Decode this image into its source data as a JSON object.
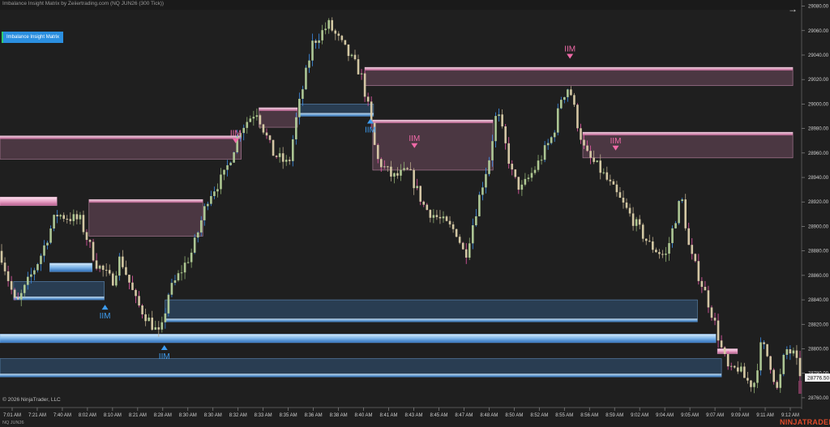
{
  "header": {
    "title": "Imbalance Insight Matrix by Zeiiertrading.com (NQ JUN26 (300 Tick))",
    "nav_icon": "arrow-right-icon"
  },
  "indicator": {
    "label": "Imbalance Insight Matrix"
  },
  "footer": {
    "copyright": "© 2026 NinjaTrader, LLC",
    "instrument": "NQ JUN26",
    "brand": "NINJATRADER"
  },
  "colors": {
    "background": "#1f1f1f",
    "bull_candle": "#b3cc96",
    "bear_candle": "#d9cda8",
    "bull_trend": "#3d8ee8",
    "bear_trend": "#e85aa8",
    "supply_zone": "#f2b8d6",
    "demand_zone": "#8ac0ee",
    "signal_bull": "#3d9cf0",
    "signal_bear": "#f06aa8"
  },
  "chart_data": {
    "type": "candlestick",
    "instrument": "NQ JUN26",
    "interval": "300 Tick",
    "price_axis": {
      "ticks": [
        28760,
        28780,
        28800,
        28820,
        28840,
        28860,
        28880,
        28900,
        28920,
        28940,
        28960,
        28980,
        29000,
        29020,
        29040,
        29060,
        29080
      ],
      "ylim": [
        28752,
        29085
      ],
      "current_price_label": "28776.50",
      "current_price": 28776.5
    },
    "time_axis": {
      "labels": [
        "7:01 AM",
        "7:21 AM",
        "7:40 AM",
        "8:02 AM",
        "8:10 AM",
        "8:21 AM",
        "8:28 AM",
        "8:30 AM",
        "8:30 AM",
        "8:32 AM",
        "8:33 AM",
        "8:35 AM",
        "8:36 AM",
        "8:38 AM",
        "8:40 AM",
        "8:41 AM",
        "8:43 AM",
        "8:45 AM",
        "8:47 AM",
        "8:48 AM",
        "8:50 AM",
        "8:52 AM",
        "8:55 AM",
        "8:56 AM",
        "8:59 AM",
        "9:02 AM",
        "9:04 AM",
        "9:05 AM",
        "9:07 AM",
        "9:09 AM",
        "9:11 AM",
        "9:12 AM"
      ]
    },
    "price_path": [
      [
        0,
        28880
      ],
      [
        0.02,
        28835
      ],
      [
        0.05,
        28875
      ],
      [
        0.07,
        28910
      ],
      [
        0.1,
        28905
      ],
      [
        0.12,
        28870
      ],
      [
        0.14,
        28855
      ],
      [
        0.15,
        28875
      ],
      [
        0.17,
        28838
      ],
      [
        0.2,
        28810
      ],
      [
        0.21,
        28845
      ],
      [
        0.24,
        28880
      ],
      [
        0.26,
        28925
      ],
      [
        0.28,
        28942
      ],
      [
        0.3,
        28980
      ],
      [
        0.32,
        28995
      ],
      [
        0.34,
        28960
      ],
      [
        0.36,
        28950
      ],
      [
        0.37,
        28990
      ],
      [
        0.39,
        29050
      ],
      [
        0.41,
        29065
      ],
      [
        0.43,
        29045
      ],
      [
        0.45,
        29025
      ],
      [
        0.46,
        28995
      ],
      [
        0.47,
        28955
      ],
      [
        0.49,
        28940
      ],
      [
        0.51,
        28945
      ],
      [
        0.53,
        28915
      ],
      [
        0.55,
        28905
      ],
      [
        0.57,
        28895
      ],
      [
        0.58,
        28875
      ],
      [
        0.6,
        28930
      ],
      [
        0.61,
        28955
      ],
      [
        0.62,
        28995
      ],
      [
        0.64,
        28940
      ],
      [
        0.65,
        28930
      ],
      [
        0.67,
        28950
      ],
      [
        0.69,
        28975
      ],
      [
        0.7,
        29005
      ],
      [
        0.71,
        29015
      ],
      [
        0.72,
        28985
      ],
      [
        0.73,
        28960
      ],
      [
        0.75,
        28945
      ],
      [
        0.77,
        28925
      ],
      [
        0.79,
        28905
      ],
      [
        0.81,
        28885
      ],
      [
        0.83,
        28875
      ],
      [
        0.85,
        28925
      ],
      [
        0.86,
        28880
      ],
      [
        0.88,
        28845
      ],
      [
        0.89,
        28825
      ],
      [
        0.9,
        28800
      ],
      [
        0.91,
        28780
      ],
      [
        0.92,
        28785
      ],
      [
        0.93,
        28775
      ],
      [
        0.94,
        28770
      ],
      [
        0.95,
        28805
      ],
      [
        0.96,
        28790
      ],
      [
        0.97,
        28765
      ],
      [
        0.98,
        28800
      ],
      [
        0.99,
        28795
      ],
      [
        1,
        28776.5
      ]
    ],
    "zones": [
      {
        "type": "supply",
        "x0": 0.0,
        "x1": 0.071,
        "y0": 28917,
        "y1": 28924
      },
      {
        "type": "supply",
        "x0": 0.111,
        "x1": 0.253,
        "y0": 28892,
        "y1": 28922
      },
      {
        "type": "supply",
        "x0": 0.0,
        "x1": 0.301,
        "y0": 28955,
        "y1": 28974
      },
      {
        "type": "supply",
        "x0": 0.323,
        "x1": 0.371,
        "y0": 28981,
        "y1": 28997
      },
      {
        "type": "supply",
        "x0": 0.465,
        "x1": 0.615,
        "y0": 28946,
        "y1": 28987
      },
      {
        "type": "supply",
        "x0": 0.455,
        "x1": 0.989,
        "y0": 29015,
        "y1": 29030
      },
      {
        "type": "supply",
        "x0": 0.727,
        "x1": 0.989,
        "y0": 28956,
        "y1": 28977
      },
      {
        "type": "supply",
        "x0": 0.895,
        "x1": 0.92,
        "y0": 28796,
        "y1": 28800
      },
      {
        "type": "demand",
        "x0": 0.062,
        "x1": 0.115,
        "y0": 28863,
        "y1": 28870
      },
      {
        "type": "demand",
        "x0": 0.017,
        "x1": 0.13,
        "y0": 28840,
        "y1": 28855
      },
      {
        "type": "demand",
        "x0": 0.373,
        "x1": 0.466,
        "y0": 28990,
        "y1": 29000
      },
      {
        "type": "demand",
        "x0": 0.206,
        "x1": 0.87,
        "y0": 28822,
        "y1": 28840
      },
      {
        "type": "demand",
        "x0": 0.0,
        "x1": 0.893,
        "y0": 28805,
        "y1": 28812
      },
      {
        "type": "demand",
        "x0": 0.0,
        "x1": 0.9,
        "y0": 28777,
        "y1": 28792
      }
    ],
    "signals": [
      {
        "label": "IIM",
        "direction": "bear",
        "x": 0.294,
        "price": 28968
      },
      {
        "label": "IIM",
        "direction": "bear",
        "x": 0.517,
        "price": 28964
      },
      {
        "label": "IIM",
        "direction": "bear",
        "x": 0.711,
        "price": 29037
      },
      {
        "label": "IIM",
        "direction": "bear",
        "x": 0.768,
        "price": 28962
      },
      {
        "label": "IIM",
        "direction": "bull",
        "x": 0.462,
        "price": 28988
      },
      {
        "label": "IIM",
        "direction": "bull",
        "x": 0.131,
        "price": 28836
      },
      {
        "label": "IIM",
        "direction": "bull",
        "x": 0.205,
        "price": 28803
      }
    ]
  }
}
